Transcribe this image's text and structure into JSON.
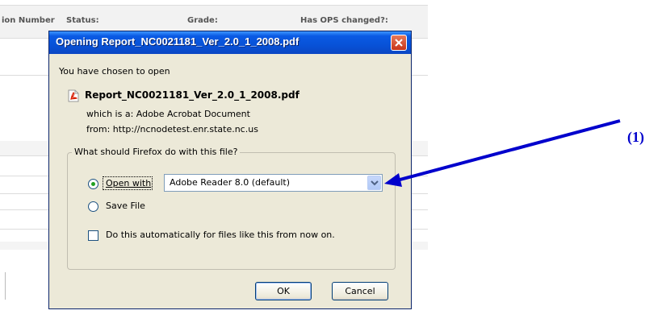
{
  "background": {
    "columns": [
      "ion Number",
      "Status:",
      "Grade:",
      "Has OPS changed?:"
    ]
  },
  "dialog": {
    "title": "Opening Report_NC0021181_Ver_2.0_1_2008.pdf",
    "intro": "You have chosen to open",
    "file_name": "Report_NC0021181_Ver_2.0_1_2008.pdf",
    "file_icon": "pdf-file-icon",
    "which_is": "which is a:  Adobe Acrobat Document",
    "from": "from:  http://ncnodetest.enr.state.nc.us",
    "group_label": "What should Firefox do with this file?",
    "open_with_label": "Open with",
    "open_with_selected": true,
    "app_value": "Adobe Reader 8.0 (default)",
    "save_file_label": "Save File",
    "save_file_selected": false,
    "auto_label": "Do this automatically for files like this from now on.",
    "auto_checked": false,
    "ok_label": "OK",
    "cancel_label": "Cancel"
  },
  "annotation": {
    "label": "(1)",
    "color": "#0000cc"
  },
  "colors": {
    "title_bar": "#0852d8",
    "dialog_bg": "#ece9d8",
    "close_button": "#c8351a"
  }
}
